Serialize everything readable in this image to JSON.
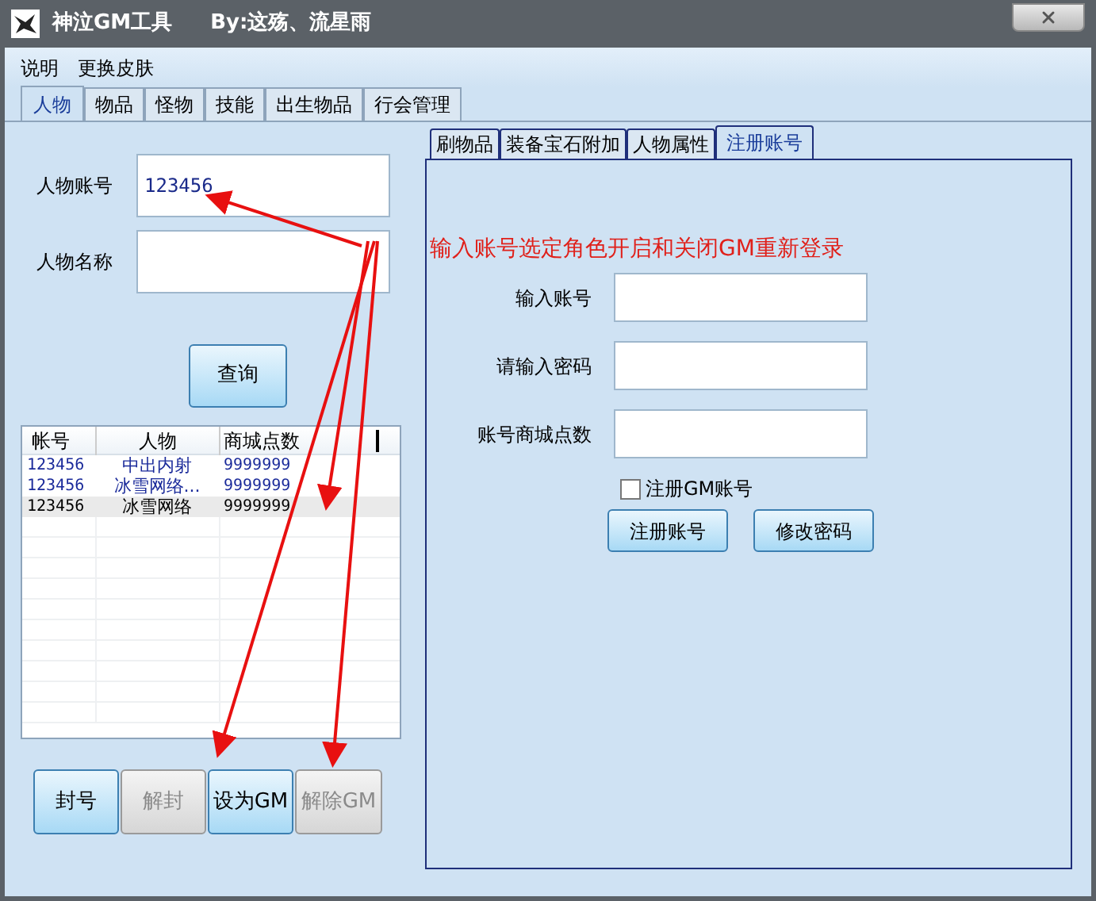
{
  "window": {
    "title": "神泣GM工具",
    "author": "By:这殇、流星雨"
  },
  "menu": [
    "说明",
    "更换皮肤"
  ],
  "tabs": [
    {
      "label": "人物",
      "selected": true
    },
    {
      "label": "物品",
      "selected": false
    },
    {
      "label": "怪物",
      "selected": false
    },
    {
      "label": "技能",
      "selected": false
    },
    {
      "label": "出生物品",
      "selected": false
    },
    {
      "label": "行会管理",
      "selected": false
    }
  ],
  "character_form": {
    "fields": [
      {
        "label": "人物账号",
        "value": "123456"
      },
      {
        "label": "人物名称"
      }
    ],
    "query_button": "查询"
  },
  "table": {
    "columns": [
      "帐号",
      "人物",
      "商城点数"
    ],
    "rows": [
      {
        "cells": [
          "123456",
          "中出内射",
          "9999999"
        ],
        "selected": false
      },
      {
        "cells": [
          "123456",
          "冰雪网络...",
          "9999999"
        ],
        "selected": false
      },
      {
        "cells": [
          "123456",
          "冰雪网络",
          "9999999"
        ],
        "selected": true
      }
    ]
  },
  "actions": [
    {
      "label": "封号",
      "disabled": false
    },
    {
      "label": "解封",
      "disabled": true
    },
    {
      "label": "设为GM",
      "disabled": false
    },
    {
      "label": "解除GM",
      "disabled": true
    }
  ],
  "sub_tabs": [
    {
      "label": "刷物品",
      "selected": false
    },
    {
      "label": "装备宝石附加",
      "selected": false
    },
    {
      "label": "人物属性",
      "selected": false
    },
    {
      "label": "注册账号",
      "selected": true
    }
  ],
  "register": {
    "note": "输入账号选定角色开启和关闭GM重新登录",
    "fields": [
      {
        "label": "输入账号"
      },
      {
        "label": "请输入密码"
      },
      {
        "label": "账号商城点数"
      }
    ],
    "gm_checkbox": {
      "label": "注册GM账号",
      "checked": false
    },
    "buttons": [
      "注册账号",
      "修改密码"
    ]
  }
}
